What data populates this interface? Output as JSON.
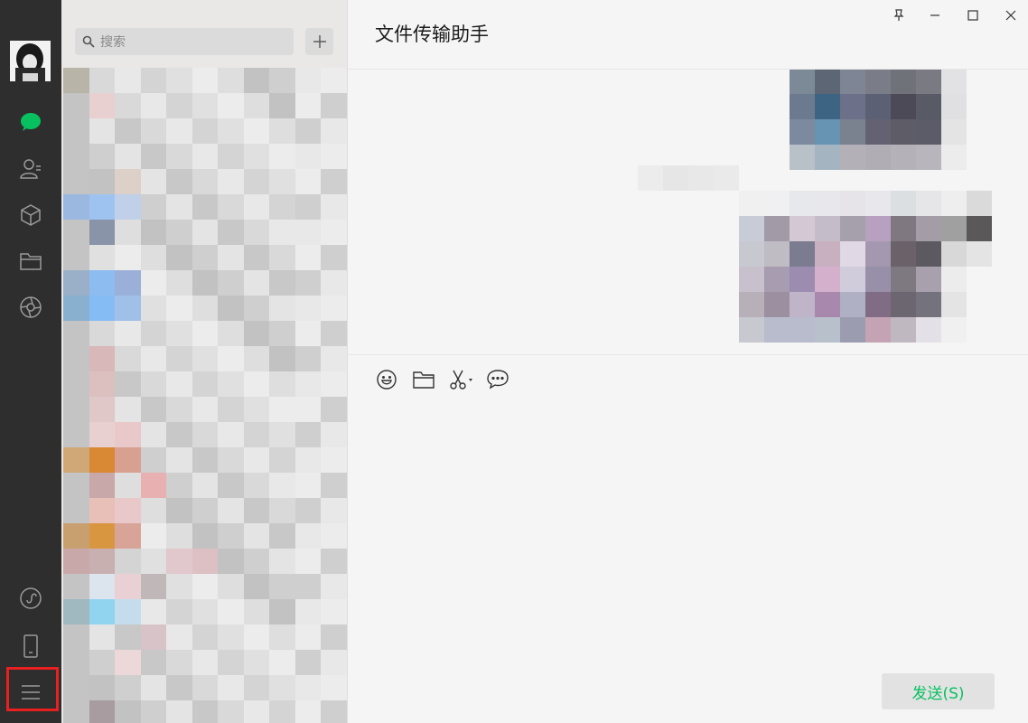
{
  "search": {
    "placeholder": "搜索"
  },
  "chat": {
    "title": "文件传输助手"
  },
  "input": {
    "send_label": "发送(S)"
  },
  "nav": {
    "items": [
      "chat-icon",
      "contacts-icon",
      "favorites-icon",
      "files-icon",
      "moments-icon"
    ],
    "bottom": [
      "mini-program-icon",
      "phone-icon",
      "menu-icon"
    ]
  },
  "colors": {
    "accent": "#07c160",
    "navbar": "#2e2e2e",
    "highlight": "#e8201f"
  }
}
